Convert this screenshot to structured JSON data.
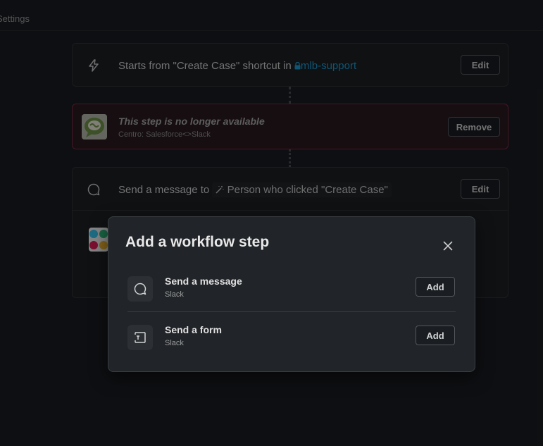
{
  "header": {
    "settings_label": "Settings"
  },
  "steps": {
    "trigger": {
      "title": "Starts from \"Create Case\" shortcut in",
      "channel": "mlb-support",
      "edit_label": "Edit",
      "icon": "bolt-icon"
    },
    "unavailable": {
      "title": "This step is no longer available",
      "subtitle": "Centro: Salesforce<>Slack",
      "remove_label": "Remove",
      "icon": "centro-app-icon"
    },
    "message": {
      "title": "Send a message to",
      "recipient": "Person who clicked \"Create Case\"",
      "edit_label": "Edit",
      "icon": "message-bubble-icon"
    }
  },
  "modal": {
    "title": "Add a workflow step",
    "close_icon": "close-icon",
    "options": [
      {
        "name": "Send a message",
        "source": "Slack",
        "add_label": "Add",
        "icon": "message-bubble-icon"
      },
      {
        "name": "Send a form",
        "source": "Slack",
        "add_label": "Add",
        "icon": "form-icon"
      }
    ]
  },
  "colors": {
    "link": "#1d9bd1",
    "error_border": "#7a2a43",
    "background": "#1a1d21"
  }
}
